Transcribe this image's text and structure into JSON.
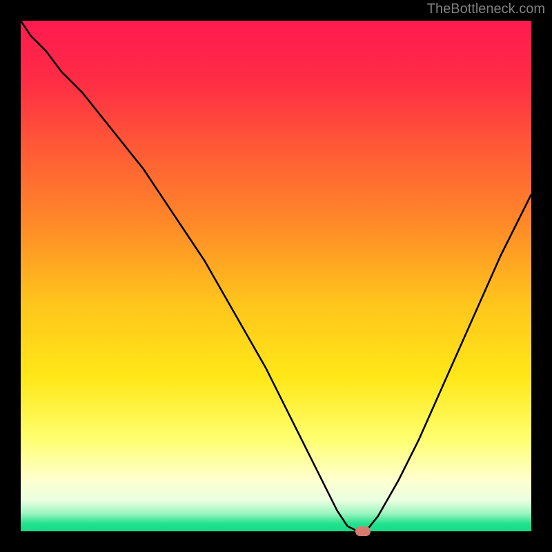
{
  "watermark": "TheBottleneck.com",
  "colors": {
    "bg": "#000000",
    "watermark": "#808080",
    "gradient_stops": [
      {
        "offset": 0.0,
        "color": "#ff1a50"
      },
      {
        "offset": 0.12,
        "color": "#ff2d45"
      },
      {
        "offset": 0.25,
        "color": "#ff5a36"
      },
      {
        "offset": 0.4,
        "color": "#ff8a28"
      },
      {
        "offset": 0.55,
        "color": "#ffc41c"
      },
      {
        "offset": 0.7,
        "color": "#ffe818"
      },
      {
        "offset": 0.82,
        "color": "#ffff70"
      },
      {
        "offset": 0.9,
        "color": "#ffffd0"
      },
      {
        "offset": 0.94,
        "color": "#eaffe0"
      },
      {
        "offset": 0.965,
        "color": "#9cf5c0"
      },
      {
        "offset": 0.985,
        "color": "#22e28e"
      },
      {
        "offset": 1.0,
        "color": "#18db86"
      }
    ],
    "curve": "#000000",
    "marker_fill": "#d77a6f",
    "marker_stroke": "#d77a6f"
  },
  "chart_data": {
    "type": "line",
    "title": "",
    "xlabel": "",
    "ylabel": "",
    "xlim": [
      0,
      100
    ],
    "ylim": [
      0,
      100
    ],
    "grid": false,
    "x": [
      0,
      2,
      5,
      8,
      12,
      16,
      20,
      24,
      28,
      32,
      36,
      40,
      44,
      48,
      52,
      54,
      56,
      58,
      60,
      62,
      64,
      66,
      68,
      70,
      74,
      78,
      82,
      86,
      90,
      94,
      98,
      100
    ],
    "values": [
      100,
      97,
      94,
      90,
      86,
      81,
      76,
      71,
      65,
      59,
      53,
      46,
      39,
      32,
      24,
      20,
      16,
      12,
      8,
      4,
      1,
      0,
      0.5,
      3,
      10,
      18,
      27,
      36,
      45,
      54,
      62,
      66
    ],
    "marker": {
      "x": 67,
      "y": 0,
      "rx": 1.5,
      "ry": 0.9
    },
    "annotations": []
  }
}
